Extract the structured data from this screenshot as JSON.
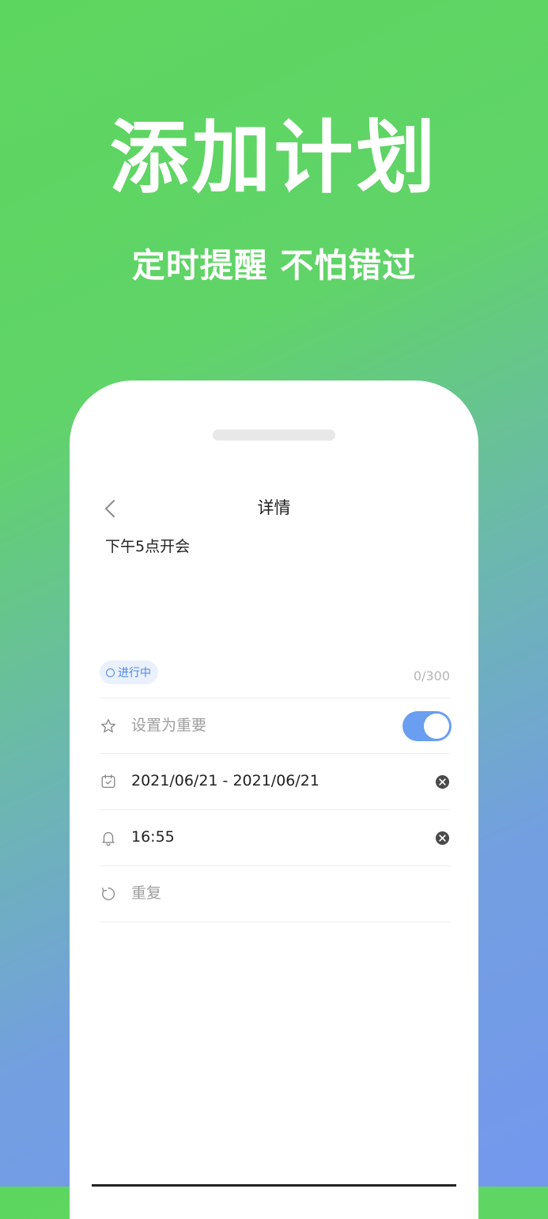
{
  "hero": {
    "title": "添加计划",
    "subtitle": "定时提醒 不怕错过"
  },
  "screen": {
    "nav_title": "详情",
    "note_text": "下午5点开会",
    "status": "进行中",
    "char_count": "0/300",
    "rows": {
      "important": {
        "label": "设置为重要",
        "icon": "star-icon",
        "toggle_on": true
      },
      "date": {
        "label": "2021/06/21 - 2021/06/21",
        "icon": "calendar-icon"
      },
      "reminder": {
        "label": "16:55",
        "icon": "bell-icon"
      },
      "repeat": {
        "label": "重复",
        "icon": "repeat-icon"
      }
    }
  },
  "colors": {
    "gradient_top": "#5dd65f",
    "gradient_bottom": "#7398ee",
    "accent": "#6a9ef0",
    "badge_text": "#4d86ea"
  }
}
